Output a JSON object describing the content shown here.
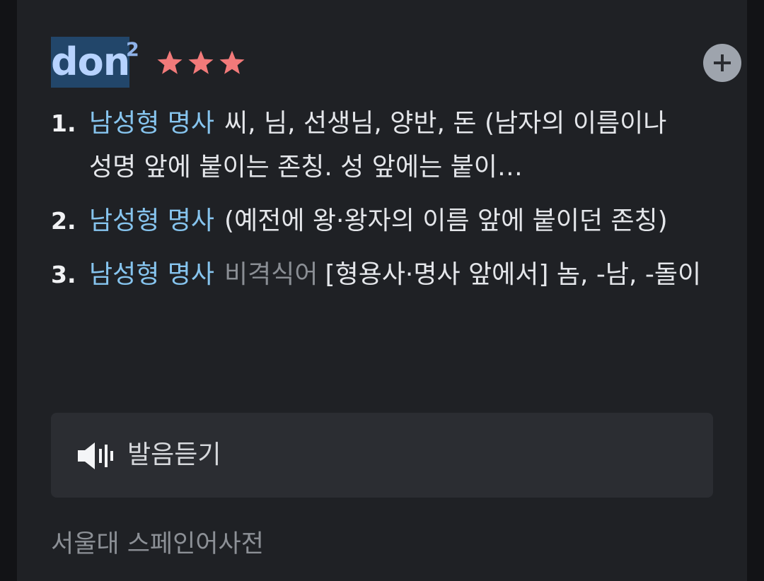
{
  "entry": {
    "headword": "don",
    "homonym_number": "2",
    "stars": 3,
    "star_color": "#f27a7a",
    "add_icon": "plus-circle-icon"
  },
  "definitions": [
    {
      "number": "1.",
      "pos": "남성형 명사",
      "register": "",
      "text": "씨, 님, 선생님, 양반, 돈 (남자의 이름이나 성명 앞에 붙이는 존칭. 성 앞에는 붙이…"
    },
    {
      "number": "2.",
      "pos": "남성형 명사",
      "register": "",
      "text": "(예전에 왕·왕자의 이름 앞에 붙이던 존칭)"
    },
    {
      "number": "3.",
      "pos": "남성형 명사",
      "register": "비격식어",
      "text": "[형용사·명사 앞에서] 놈, -남, -돌이"
    }
  ],
  "pronunciation": {
    "label": "발음듣기",
    "icon": "speaker-icon"
  },
  "source": "서울대 스페인어사전",
  "colors": {
    "background": "#121316",
    "card": "#1f2125",
    "headword_highlight": "#22466a",
    "headword_text": "#b7d3ff",
    "pos": "#86c4ee",
    "register": "#8a8e94"
  }
}
